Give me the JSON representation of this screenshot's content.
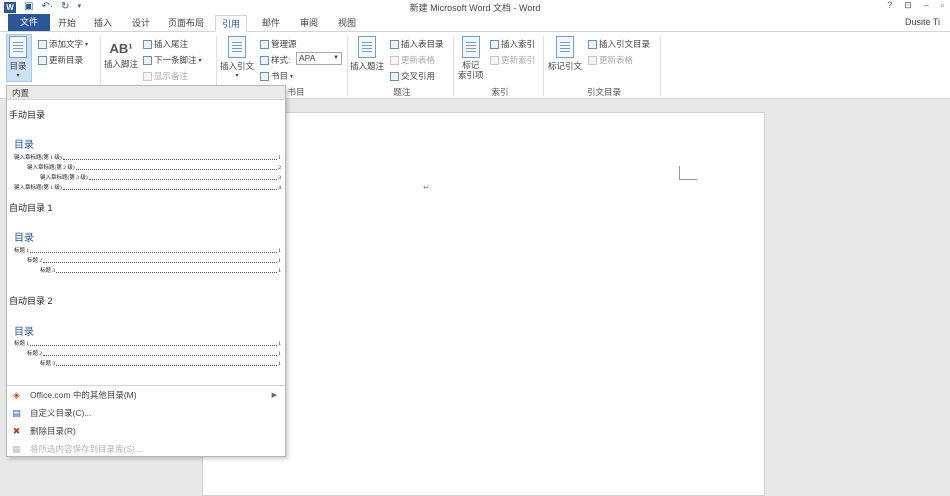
{
  "titlebar": {
    "title": "新建 Microsoft Word 文档 - Word",
    "logo": "W",
    "controls": [
      "?",
      "⊡",
      "–",
      "▫"
    ]
  },
  "tabs": [
    {
      "label": "文件"
    },
    {
      "label": "开始"
    },
    {
      "label": "插入"
    },
    {
      "label": "设计"
    },
    {
      "label": "页面布局"
    },
    {
      "label": "引用"
    },
    {
      "label": "邮件"
    },
    {
      "label": "审阅"
    },
    {
      "label": "视图"
    }
  ],
  "user": {
    "name": "Dusite Ti"
  },
  "ribbon": {
    "toc": {
      "label": "目录"
    },
    "add_text": "添加文字",
    "update_toc": "更新目录",
    "insert_footnote": "插入脚注",
    "insert_endnote": "插入尾注",
    "next_footnote": "下一条脚注",
    "show_notes": "显示备注",
    "insert_citation": "插入引文",
    "manage_sources": "管理源",
    "style_label": "样式:",
    "style_value": "APA",
    "bibliography": "书目",
    "group_citations": "书目",
    "insert_caption": "插入题注",
    "insert_table_of_figures": "插入表目录",
    "update_table": "更新表格",
    "cross_reference": "交叉引用",
    "group_captions": "题注",
    "mark_entry": "标记\n索引项",
    "insert_index": "插入索引",
    "update_index": "更新索引",
    "group_index": "索引",
    "mark_citation": "标记引文",
    "insert_toa": "插入引文目录",
    "update_toa": "更新表格",
    "group_toa": "引文目录"
  },
  "dropdown": {
    "header": "内置",
    "manual": {
      "title": "手动目录",
      "heading": "目录",
      "lines": [
        {
          "text": "键入章标题(第 1 级)",
          "page": "1"
        },
        {
          "text": "键入章标题(第 2 级)",
          "page": "2"
        },
        {
          "text": "键入章标题(第 3 级)",
          "page": "3"
        },
        {
          "text": "键入章标题(第 1 级)",
          "page": "4"
        }
      ]
    },
    "auto1": {
      "title": "自动目录 1",
      "heading": "目录",
      "lines": [
        {
          "text": "标题 1",
          "page": "1"
        },
        {
          "text": "标题 2",
          "page": "1"
        },
        {
          "text": "标题 3",
          "page": "1"
        }
      ]
    },
    "auto2": {
      "title": "自动目录 2",
      "heading": "目录",
      "lines": [
        {
          "text": "标题 1",
          "page": "1"
        },
        {
          "text": "标题 2",
          "page": "1"
        },
        {
          "text": "标题 3",
          "page": "1"
        }
      ]
    },
    "menu": [
      {
        "label": "Office.com 中的其他目录(M)",
        "icon": "office-icon"
      },
      {
        "label": "自定义目录(C)...",
        "icon": "custom-toc-icon"
      },
      {
        "label": "删除目录(R)",
        "icon": "remove-toc-icon"
      },
      {
        "label": "将所选内容保存到目录库(S)...",
        "icon": "save-selection-icon"
      }
    ]
  },
  "document": {
    "paragraph_mark": "↵"
  }
}
